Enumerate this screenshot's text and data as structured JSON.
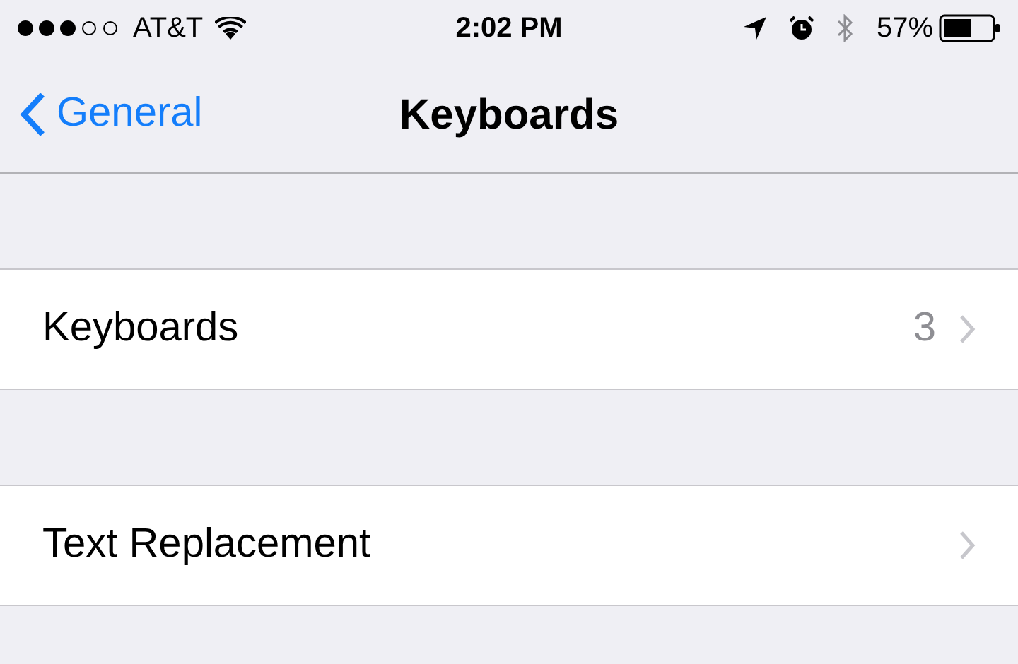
{
  "status_bar": {
    "carrier": "AT&T",
    "time": "2:02 PM",
    "battery": "57%"
  },
  "nav_bar": {
    "back": "General",
    "title": "Keyboards"
  },
  "groups": [
    {
      "rows": [
        {
          "label": "Keyboards",
          "value": "3"
        }
      ]
    },
    {
      "rows": [
        {
          "label": "Text Replacement"
        }
      ]
    }
  ]
}
